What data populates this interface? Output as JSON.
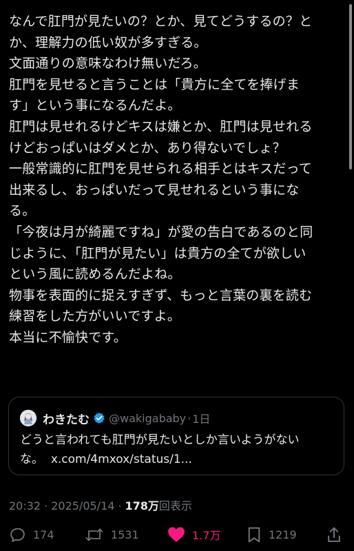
{
  "post": {
    "lines": [
      "なんで肛門が見たいの？とか、見てどうするの？と",
      "か、理解力の低い奴が多すぎる。",
      "文面通りの意味なわけ無いだろ。",
      "肛門を見せると言うことは「貴方に全てを捧げま",
      "す」という事になるんだよ。",
      "肛門は見せれるけどキスは嫌とか、肛門は見せれる",
      "けどおっぱいはダメとか、あり得ないでしょ？",
      "一般常識的に肛門を見せられる相手とはキスだって",
      "出来るし、おっぱいだって見せれるという事にな",
      "る。",
      "「今夜は月が綺麗ですね」が愛の告白であるのと同",
      "じように、「肛門が見たい」は貴方の全てが欲しい",
      "という風に読めるんだよね。",
      "物事を表面的に捉えすぎず、もっと言葉の裏を読む",
      "練習をした方がいいですよ。",
      "本当に不愉快です。"
    ]
  },
  "quote": {
    "avatar_icon": "avatar",
    "name": "わきたむ",
    "verified_icon": "verified-badge-icon",
    "handle": "@wakigababy",
    "dot": "·",
    "time": "1日",
    "text_line1": "どうと言われても肛門が見たいとしか言いようがない",
    "text_line2_prefix": "な。",
    "link": "x.com/4mxox/status/1..."
  },
  "meta": {
    "time": "20:32",
    "sep1": "·",
    "date": "2025/05/14",
    "sep2": "·",
    "views_count": "178万",
    "views_label": "回表示"
  },
  "actions": {
    "replies": "174",
    "reposts": "1531",
    "likes": "1.7万",
    "bookmarks": "1219"
  },
  "colors": {
    "background": "#000000",
    "text": "#e7e9ea",
    "muted": "#71767b",
    "like": "#f91880",
    "verified": "#1d9bf0",
    "border": "#2f3336"
  }
}
